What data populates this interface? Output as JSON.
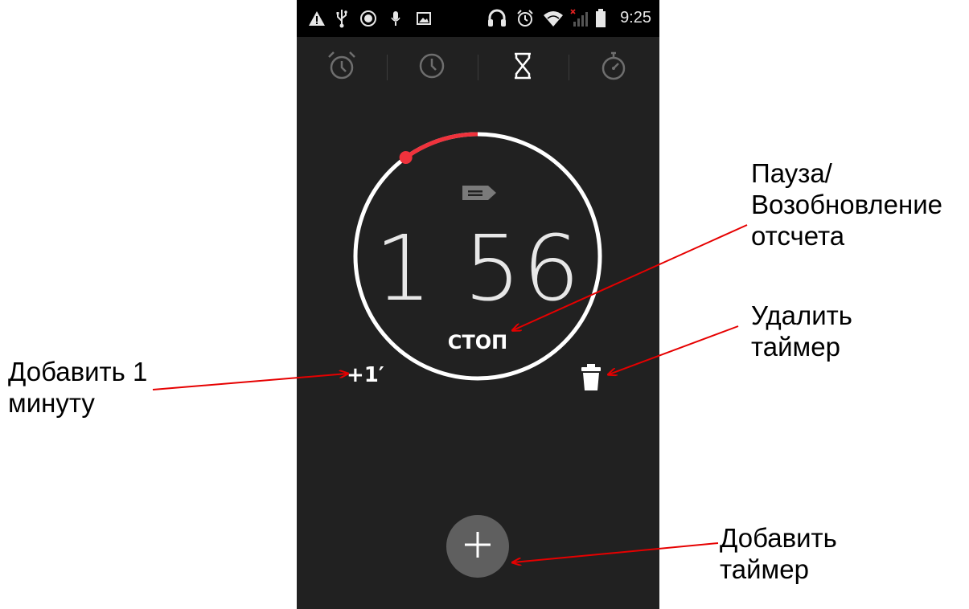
{
  "status_bar": {
    "left_icons": [
      "warning-icon",
      "usb-icon",
      "fm-radio-icon",
      "microphone-icon",
      "image-icon"
    ],
    "right_icons": [
      "headset-icon",
      "alarm-icon",
      "wifi-icon",
      "signal-no-sim-icon",
      "battery-icon"
    ],
    "time": "9:25"
  },
  "tabs": [
    {
      "icon": "alarm-clock-icon",
      "active": false
    },
    {
      "icon": "clock-icon",
      "active": false
    },
    {
      "icon": "hourglass-icon",
      "active": true
    },
    {
      "icon": "stopwatch-icon",
      "active": false
    }
  ],
  "timer": {
    "label_icon": "label-tag-icon",
    "remaining_display": "1 56",
    "stop_label": "СТОП",
    "add_minute_label": "+1′",
    "elapsed_fraction": 0.1,
    "ring_color": "#ffffff",
    "elapsed_color": "#f0323c"
  },
  "fab": {
    "icon": "plus-icon"
  },
  "annotations": {
    "pause": "Пауза/\nВозобновление\nотсчета",
    "delete": "Удалить\nтаймер",
    "add_minute": "Добавить 1\nминуту",
    "add_timer": "Добавить\nтаймер",
    "arrow_color": "#e60000"
  }
}
